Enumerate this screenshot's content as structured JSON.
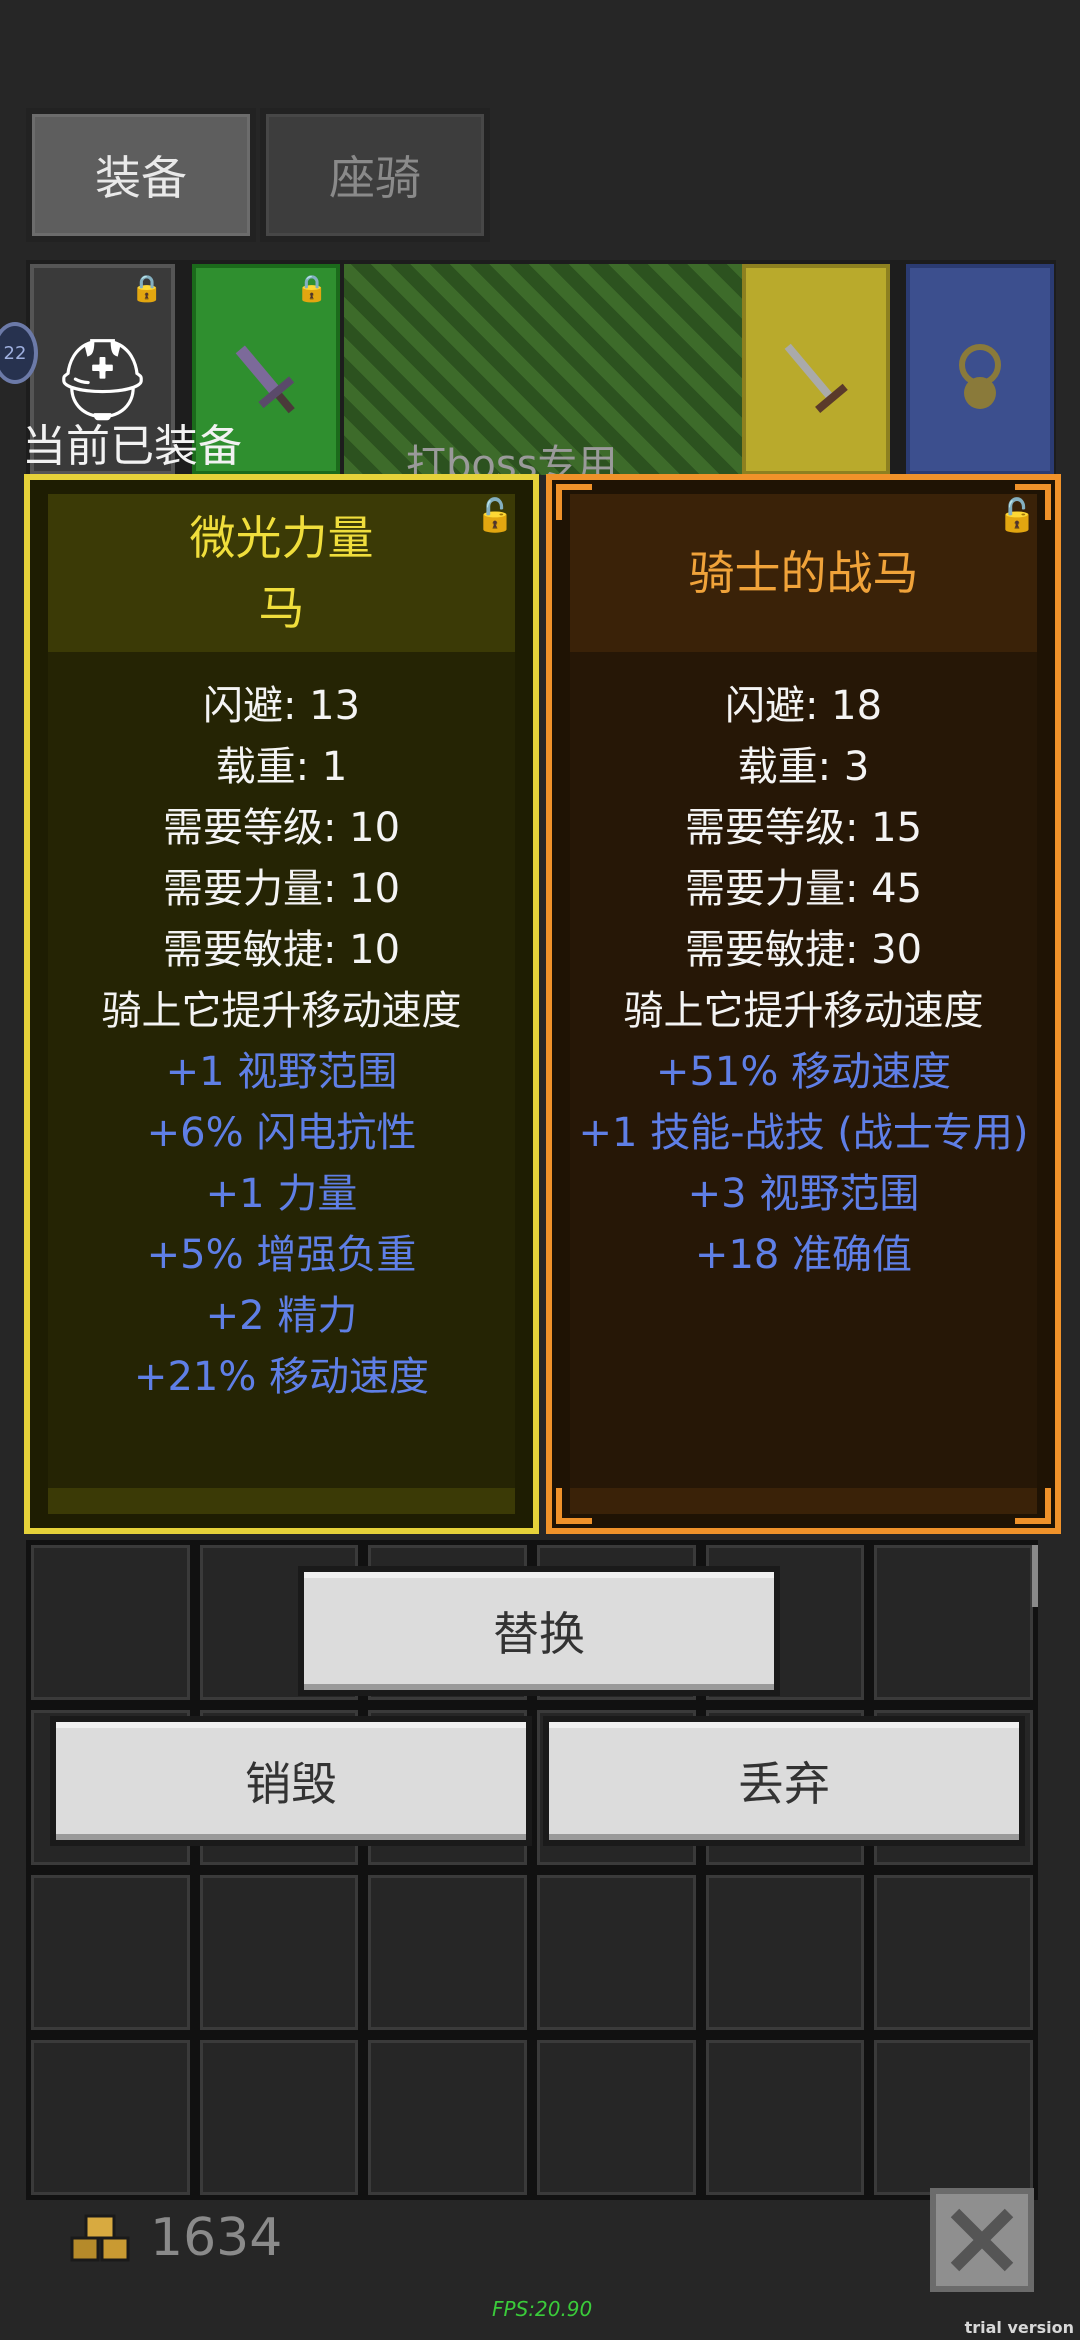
{
  "tabs": [
    {
      "label": "装备",
      "active": true
    },
    {
      "label": "座骑",
      "active": false
    }
  ],
  "level_badge": "22",
  "strip": {
    "boss_tag": "打boss专用"
  },
  "equipped_label": "当前已装备",
  "card_current": {
    "title_line1": "微光力量",
    "title_line2": "马",
    "stats": [
      {
        "text": "闪避: 13",
        "kind": "base"
      },
      {
        "text": "载重: 1",
        "kind": "base"
      },
      {
        "text": "需要等级: 10",
        "kind": "base"
      },
      {
        "text": "需要力量: 10",
        "kind": "base"
      },
      {
        "text": "需要敏捷: 10",
        "kind": "base"
      },
      {
        "text": "骑上它提升移动速度",
        "kind": "base"
      },
      {
        "text": "+1 视野范围",
        "kind": "bonus"
      },
      {
        "text": "+6% 闪电抗性",
        "kind": "bonus"
      },
      {
        "text": "+1 力量",
        "kind": "bonus"
      },
      {
        "text": "+5% 增强负重",
        "kind": "bonus"
      },
      {
        "text": "+2 精力",
        "kind": "bonus"
      },
      {
        "text": "+21% 移动速度",
        "kind": "bonus"
      }
    ],
    "rarity_color": "#e6d23a"
  },
  "card_new": {
    "title_line1": "骑士的战马",
    "stats": [
      {
        "text": "闪避: 18",
        "kind": "base"
      },
      {
        "text": "载重: 3",
        "kind": "base"
      },
      {
        "text": "需要等级: 15",
        "kind": "base"
      },
      {
        "text": "需要力量: 45",
        "kind": "base"
      },
      {
        "text": "需要敏捷: 30",
        "kind": "base"
      },
      {
        "text": "骑上它提升移动速度",
        "kind": "base"
      },
      {
        "text": "+51% 移动速度",
        "kind": "bonus"
      },
      {
        "text": "+1 技能-战技 (战士专用)",
        "kind": "bonus"
      },
      {
        "text": "+3 视野范围",
        "kind": "bonus"
      },
      {
        "text": "+18 准确值",
        "kind": "bonus"
      }
    ],
    "rarity_color": "#f0922a"
  },
  "buttons": {
    "replace": "替换",
    "destroy": "销毁",
    "discard": "丢弃"
  },
  "gold": "1634",
  "fps": "FPS:20.90",
  "trial": "trial version",
  "icons": {
    "helmet": "helmet-icon",
    "sword": "sword-icon",
    "lock": "lock-icon",
    "gold": "gold-icon",
    "close": "close-icon"
  }
}
